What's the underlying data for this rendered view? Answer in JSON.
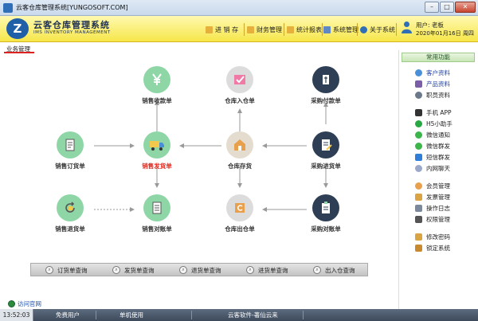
{
  "window": {
    "title": "云客仓库管理系统[YUNGOSOFT.COM]",
    "min": "–",
    "max": "□",
    "close": "✕"
  },
  "brand": {
    "logo_letter": "Z",
    "title": "云客仓库管理系统",
    "subtitle": "IMS INVENTORY MANAGEMENT"
  },
  "menu": [
    {
      "label": "进 销 存",
      "icon": "folder-icon"
    },
    {
      "label": "财务管理",
      "icon": "folder-icon"
    },
    {
      "label": "统计报表",
      "icon": "folder-icon"
    },
    {
      "label": "系统管理",
      "icon": "system-icon"
    },
    {
      "label": "关于系统",
      "icon": "info-icon"
    }
  ],
  "user": {
    "line1": "用户: 老板",
    "line2": "2020年01月16日 周四"
  },
  "tab": {
    "label": "业务管理"
  },
  "flow": {
    "sales_receipt": "销售收款单",
    "stock_in": "仓库入仓单",
    "purchase_payment": "采购付款单",
    "sales_order": "销售订货单",
    "sales_delivery": "销售发货单",
    "inventory": "仓库存货",
    "purchase_receipt": "采购进货单",
    "sales_return": "销售退货单",
    "sales_reconcile": "销售对账单",
    "stock_out": "仓库出仓单",
    "purchase_reconcile": "采购对账单"
  },
  "query_bar": [
    "订货单查询",
    "发货单查询",
    "退货单查询",
    "进货单查询",
    "出入仓查询"
  ],
  "visit_site": "访问官网",
  "right_panel": {
    "header": "常用功能",
    "links": [
      "客户资料",
      "产品资料",
      "职员资料"
    ],
    "tools": [
      "手机 APP",
      "H5小助手",
      "微信通知",
      "微信群发",
      "短信群发",
      "内网聊天"
    ],
    "admin": [
      "会员管理",
      "发票管理",
      "操作日志",
      "权限管理"
    ],
    "security": [
      "修改密码",
      "锁定系统"
    ]
  },
  "status": {
    "time": "13:52:03",
    "user_type": "免费用户",
    "mode": "单机使用",
    "company": "云客软件-著仙云来"
  },
  "colors": {
    "header_yellow": "#f6e64a",
    "node_green": "#8ed6a6",
    "node_navy": "#2e3f55",
    "accent_red": "#e0261b",
    "link_blue": "#1c3fa6"
  }
}
